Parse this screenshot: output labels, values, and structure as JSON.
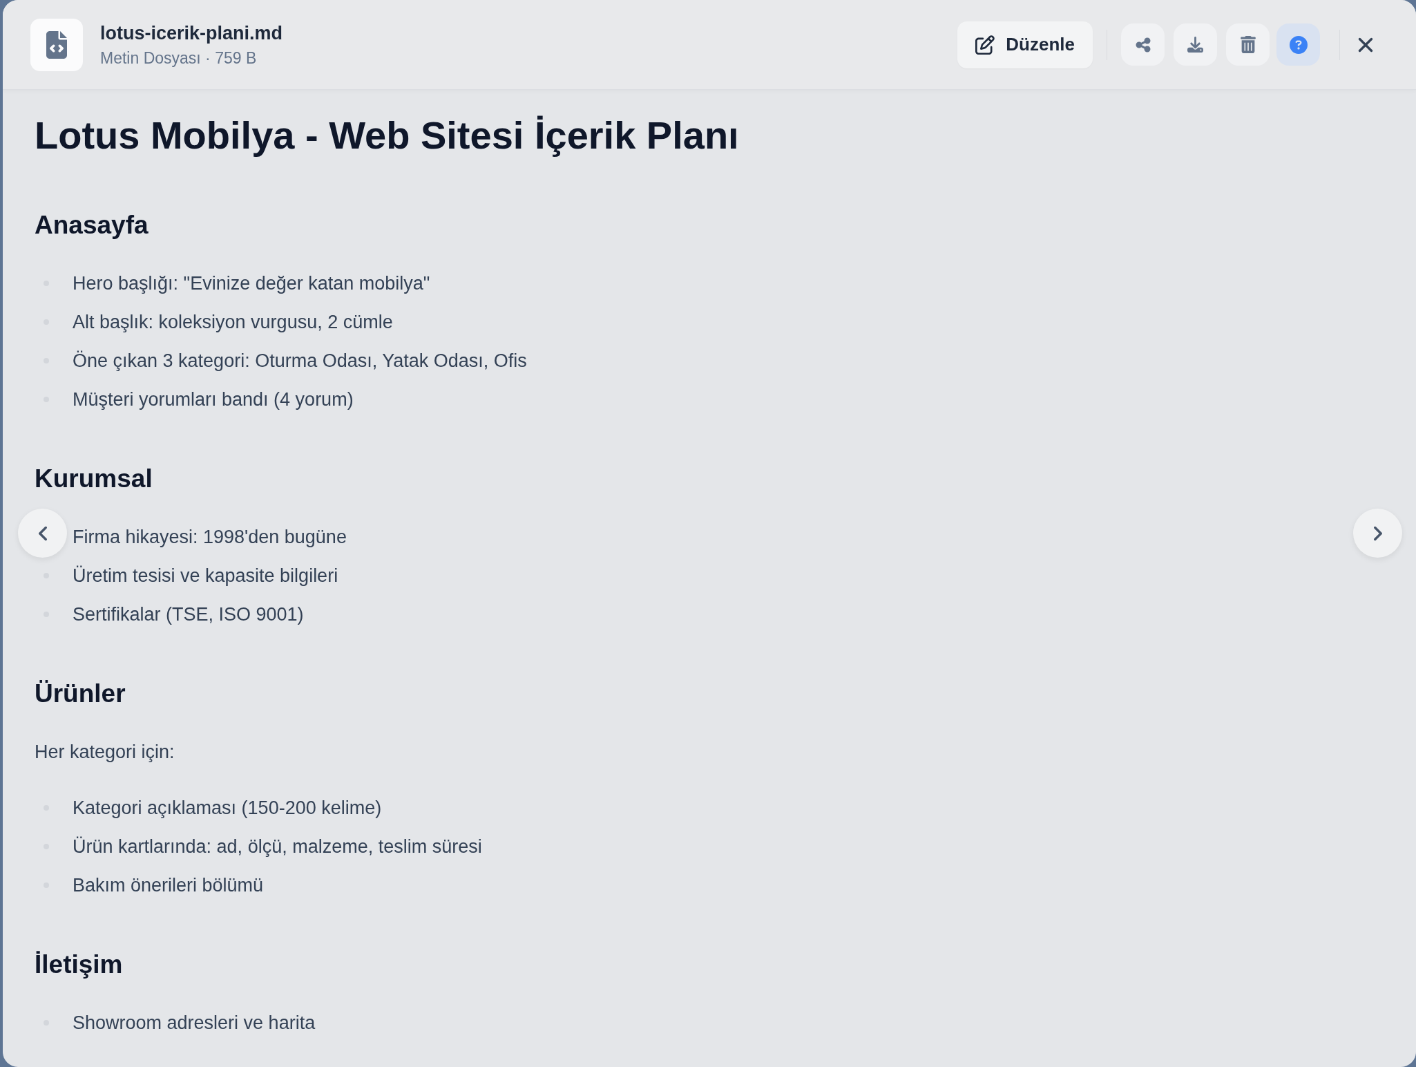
{
  "header": {
    "file_name": "lotus-icerik-plani.md",
    "file_meta": "Metin Dosyası · 759 B",
    "actions": [
      {
        "kind": "edit",
        "label": "Düzenle",
        "selected": false
      },
      {
        "kind": "share",
        "selected": false
      },
      {
        "kind": "download",
        "selected": false
      },
      {
        "kind": "delete",
        "selected": false
      },
      {
        "kind": "help",
        "selected": true
      },
      {
        "kind": "close",
        "selected": false
      }
    ]
  },
  "document": {
    "title": "Lotus Mobilya - Web Sitesi İçerik Planı",
    "sections": [
      {
        "heading": "Anasayfa",
        "blocks": [
          {
            "kind": "list",
            "items": [
              "Hero başlığı: \"Evinize değer katan mobilya\"",
              "Alt başlık: koleksiyon vurgusu, 2 cümle",
              "Öne çıkan 3 kategori: Oturma Odası, Yatak Odası, Ofis",
              "Müşteri yorumları bandı (4 yorum)"
            ]
          }
        ]
      },
      {
        "heading": "Kurumsal",
        "blocks": [
          {
            "kind": "list",
            "items": [
              "Firma hikayesi: 1998'den bugüne",
              "Üretim tesisi ve kapasite bilgileri",
              "Sertifikalar (TSE, ISO 9001)"
            ]
          }
        ]
      },
      {
        "heading": "Ürünler",
        "blocks": [
          {
            "kind": "paragraph",
            "text": "Her kategori için:"
          },
          {
            "kind": "list",
            "items": [
              "Kategori açıklaması (150-200 kelime)",
              "Ürün kartlarında: ad, ölçü, malzeme, teslim süresi",
              "Bakım önerileri bölümü"
            ]
          }
        ]
      },
      {
        "heading": "İletişim",
        "blocks": [
          {
            "kind": "list",
            "items": [
              "Showroom adresleri ve harita"
            ]
          }
        ]
      }
    ]
  }
}
